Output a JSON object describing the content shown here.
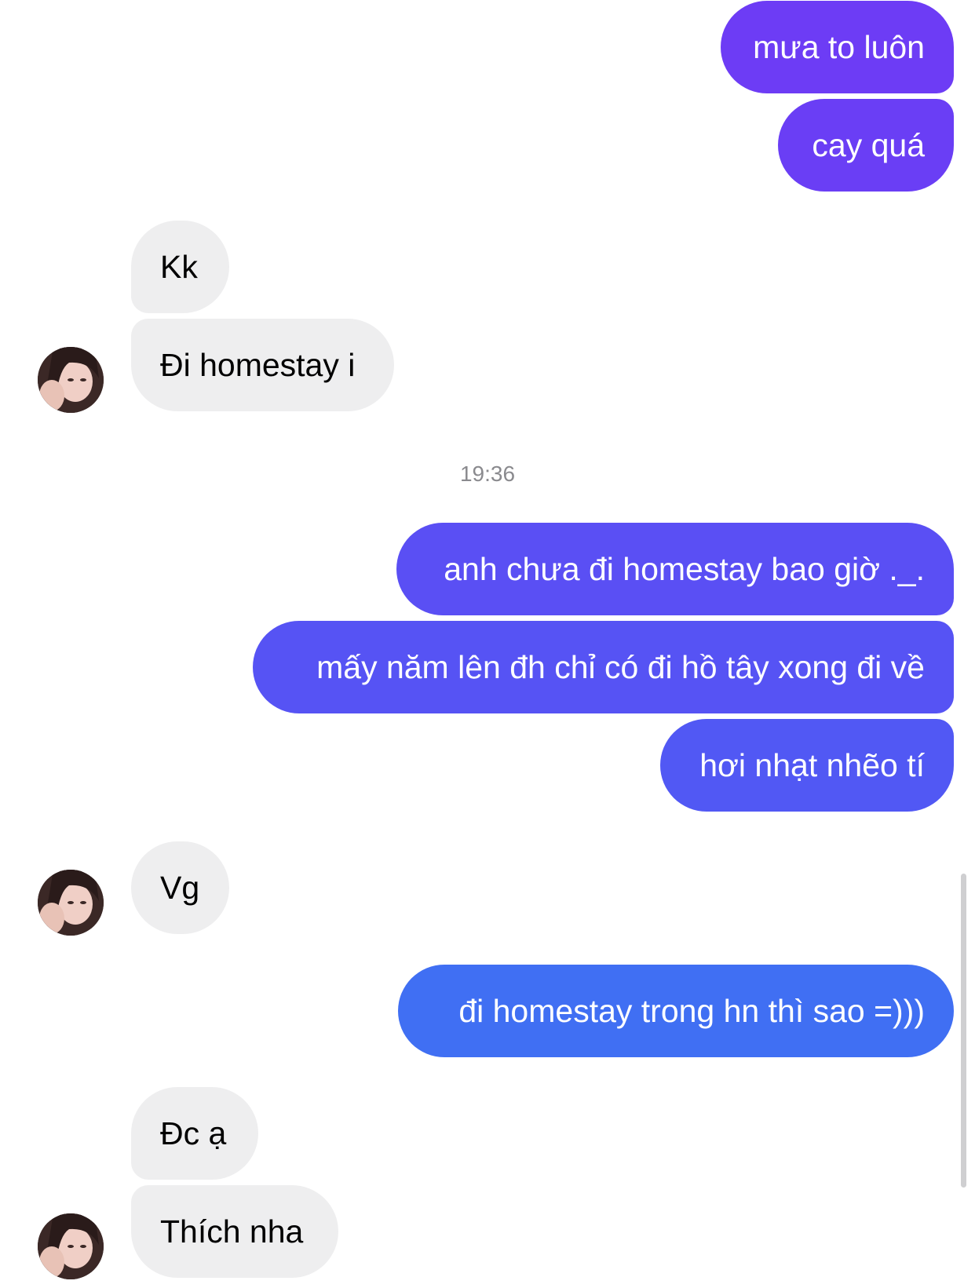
{
  "timestamp": "19:36",
  "colors": {
    "sent_gradient": [
      "#6d3cf5",
      "#5653f4",
      "#406ff3"
    ],
    "received_bg": "#eeeeef",
    "timestamp": "#8a8a8e"
  },
  "messages": [
    {
      "sender": "me",
      "text": "mưa to luôn"
    },
    {
      "sender": "me",
      "text": "cay quá"
    },
    {
      "sender": "them",
      "text": "Kk"
    },
    {
      "sender": "them",
      "text": "Đi homestay i"
    },
    {
      "sender": "me",
      "text": "anh chưa đi homestay bao giờ ._."
    },
    {
      "sender": "me",
      "text": "mấy năm lên đh chỉ có đi hồ tây xong đi về"
    },
    {
      "sender": "me",
      "text": "hơi nhạt nhẽo tí"
    },
    {
      "sender": "them",
      "text": "Vg"
    },
    {
      "sender": "me",
      "text": "đi homestay trong hn thì sao =)))"
    },
    {
      "sender": "them",
      "text": "Đc ạ"
    },
    {
      "sender": "them",
      "text": "Thích nha"
    }
  ],
  "avatar_icon": "contact-avatar-photo"
}
